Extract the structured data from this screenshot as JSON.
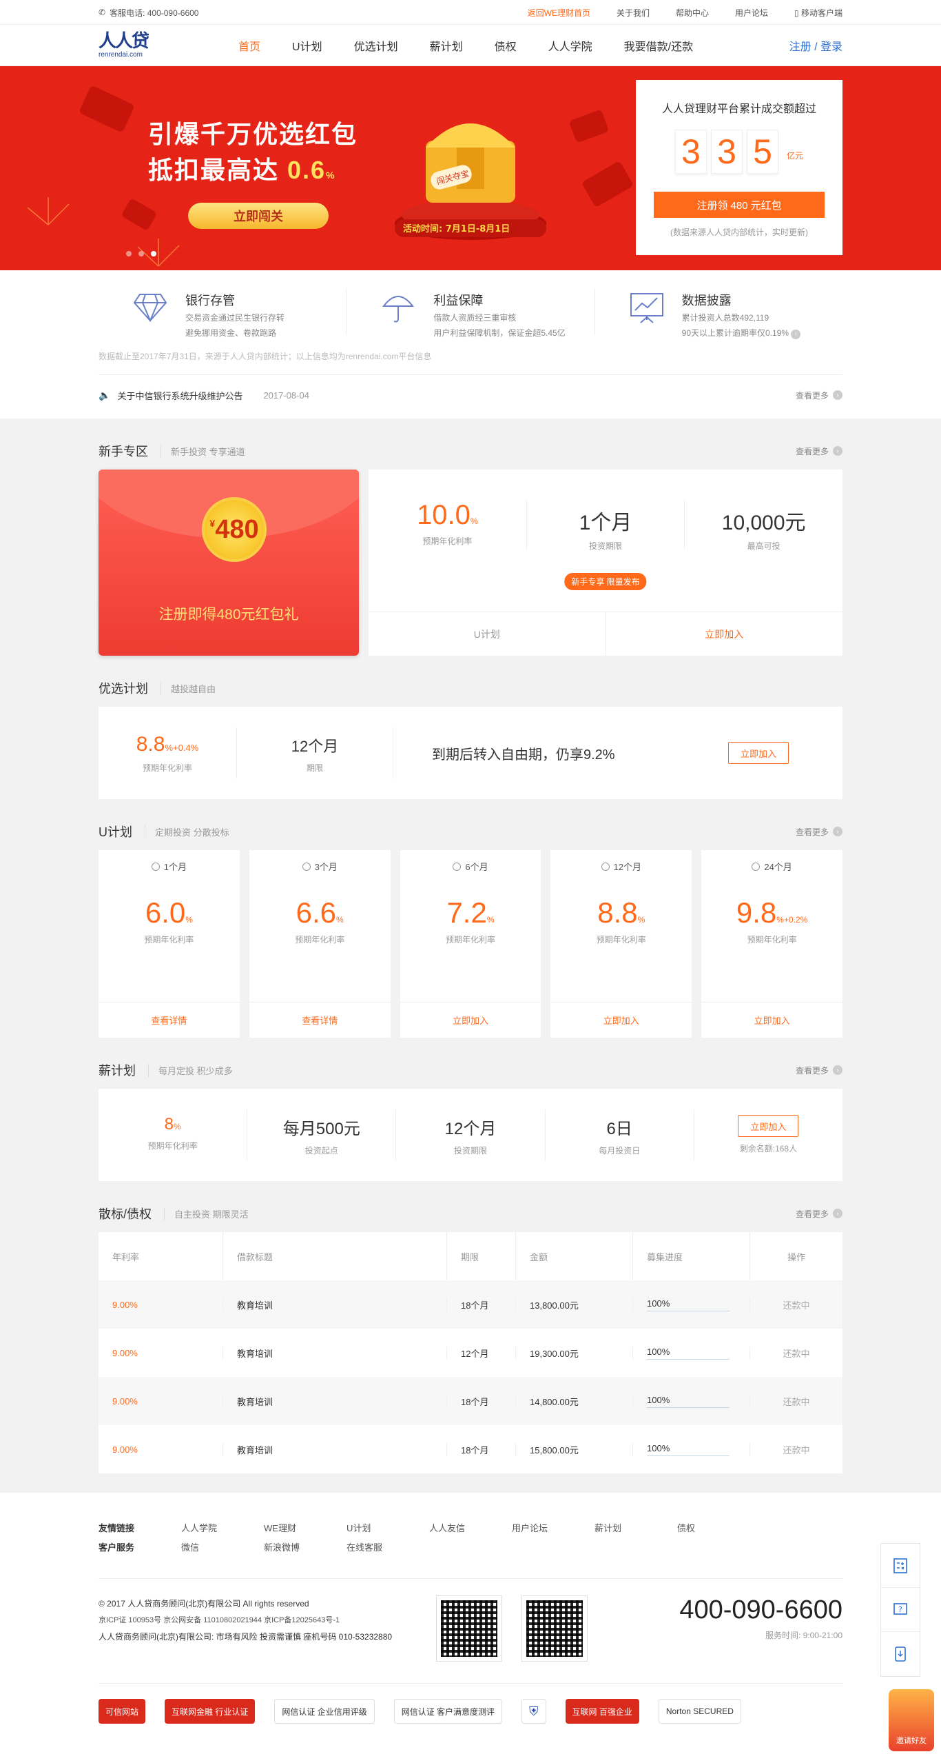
{
  "topbar": {
    "phone": "客服电话: 400-090-6600",
    "links": [
      "返回WE理财首页",
      "关于我们",
      "帮助中心",
      "用户论坛",
      "移动客户端"
    ]
  },
  "nav": {
    "logo_text": "renrendai.com",
    "logo_mark": "人人贷",
    "menu": [
      "首页",
      "U计划",
      "优选计划",
      "薪计划",
      "债权",
      "人人学院",
      "我要借款/还款"
    ],
    "auth": "注册 / 登录"
  },
  "banner": {
    "line1": "引爆千万优选红包",
    "line2": "抵扣最高达",
    "line2_num": "0.6",
    "line2_unit": "%",
    "button": "立即闯关",
    "badge": "闯关夺宝",
    "activity": "活动时间: 7月1日-8月1日",
    "stat_title": "人人贷理财平台累计成交额超过",
    "digits": [
      "3",
      "3",
      "5"
    ],
    "digits_unit": "亿元",
    "register": "注册领 480 元红包",
    "note": "(数据来源人人贷内部统计，实时更新)"
  },
  "features": [
    {
      "title": "银行存管",
      "line1": "交易资金通过民生银行存转",
      "line2": "避免挪用资金、卷款跑路",
      "icon": "diamond-icon"
    },
    {
      "title": "利益保障",
      "line1": "借款人资质经三重审核",
      "line2": "用户利益保障机制，保证金超5.45亿",
      "icon": "umbrella-icon"
    },
    {
      "title": "数据披露",
      "line1": "累计投资人总数492,119",
      "line2": "90天以上累计逾期率仅0.19%",
      "icon": "chart-board-icon"
    }
  ],
  "data_note": "数据截止至2017年7月31日，来源于人人贷内部统计；以上信息均为renrendai.com平台信息",
  "notice": {
    "text": "关于中信银行系统升级维护公告",
    "date": "2017-08-04",
    "more": "查看更多"
  },
  "newbie": {
    "title": "新手专区",
    "sub": "新手投资 专享通道",
    "more": "查看更多",
    "coin": "480",
    "coin_sym": "¥",
    "pack_text": "注册即得480元红包礼",
    "rate": "10.0",
    "rate_unit": "%",
    "rate_label": "预期年化利率",
    "term": "1个月",
    "term_label": "投资期限",
    "max": "10,000元",
    "max_label": "最高可投",
    "badge": "新手专享 限量发布",
    "foot_left": "U计划",
    "foot_right": "立即加入"
  },
  "youxuan": {
    "title": "优选计划",
    "sub": "越投越自由",
    "rate": "8.8",
    "rate_unit": "%",
    "rate_extra": "+0.4%",
    "rate_label": "预期年化利率",
    "term": "12个月",
    "term_label": "期限",
    "desc": "到期后转入自由期，仍享9.2%",
    "button": "立即加入"
  },
  "uplan": {
    "title": "U计划",
    "sub": "定期投资 分散投标",
    "more": "查看更多",
    "rate_label": "预期年化利率",
    "items": [
      {
        "period": "1个月",
        "rate": "6.0",
        "unit": "%",
        "extra": "",
        "action": "查看详情"
      },
      {
        "period": "3个月",
        "rate": "6.6",
        "unit": "%",
        "extra": "",
        "action": "查看详情"
      },
      {
        "period": "6个月",
        "rate": "7.2",
        "unit": "%",
        "extra": "",
        "action": "立即加入"
      },
      {
        "period": "12个月",
        "rate": "8.8",
        "unit": "%",
        "extra": "",
        "action": "立即加入"
      },
      {
        "period": "24个月",
        "rate": "9.8",
        "unit": "%",
        "extra": "+0.2%",
        "action": "立即加入"
      }
    ]
  },
  "xin": {
    "title": "薪计划",
    "sub": "每月定投 积少成多",
    "more": "查看更多",
    "rate": "8",
    "rate_unit": "%",
    "rate_label": "预期年化利率",
    "start": "每月500元",
    "start_label": "投资起点",
    "term": "12个月",
    "term_label": "投资期限",
    "day": "6日",
    "day_label": "每月投资日",
    "button": "立即加入",
    "remain": "剩余名额:168人"
  },
  "loans": {
    "title": "散标/债权",
    "sub": "自主投资 期限灵活",
    "more": "查看更多",
    "headers": [
      "年利率",
      "借款标题",
      "期限",
      "金额",
      "募集进度",
      "操作"
    ],
    "rows": [
      {
        "rate": "9.00%",
        "title": "教育培训",
        "term": "18个月",
        "amount": "13,800.00元",
        "progress": "100%",
        "op": "还款中"
      },
      {
        "rate": "9.00%",
        "title": "教育培训",
        "term": "12个月",
        "amount": "19,300.00元",
        "progress": "100%",
        "op": "还款中"
      },
      {
        "rate": "9.00%",
        "title": "教育培训",
        "term": "18个月",
        "amount": "14,800.00元",
        "progress": "100%",
        "op": "还款中"
      },
      {
        "rate": "9.00%",
        "title": "教育培训",
        "term": "18个月",
        "amount": "15,800.00元",
        "progress": "100%",
        "op": "还款中"
      }
    ]
  },
  "footer": {
    "row1": [
      "友情链接",
      "人人学院",
      "WE理财",
      "U计划",
      "人人友信",
      "用户论坛",
      "薪计划",
      "债权"
    ],
    "row2": [
      "客户服务",
      "微信",
      "新浪微博",
      "在线客服"
    ],
    "copyright": "© 2017 人人贷商务顾问(北京)有限公司 All rights reserved",
    "icp": "京ICP证 100953号 京公网安备 11010802021944 京ICP备12025643号-1",
    "risk": "人人贷商务顾问(北京)有限公司: 市场有风险 投资需谨慎 座机号码 010-53232880",
    "tel": "400-090-6600",
    "hours": "服务时间: 9:00-21:00",
    "certs": [
      "可信网站",
      "互联网金融 行业认证",
      "网信认证 企业信用评级",
      "网信认证 客户满意度测评",
      "",
      "互联网 百强企业",
      "Norton SECURED"
    ]
  },
  "side": {
    "gift": "邀请好友"
  }
}
